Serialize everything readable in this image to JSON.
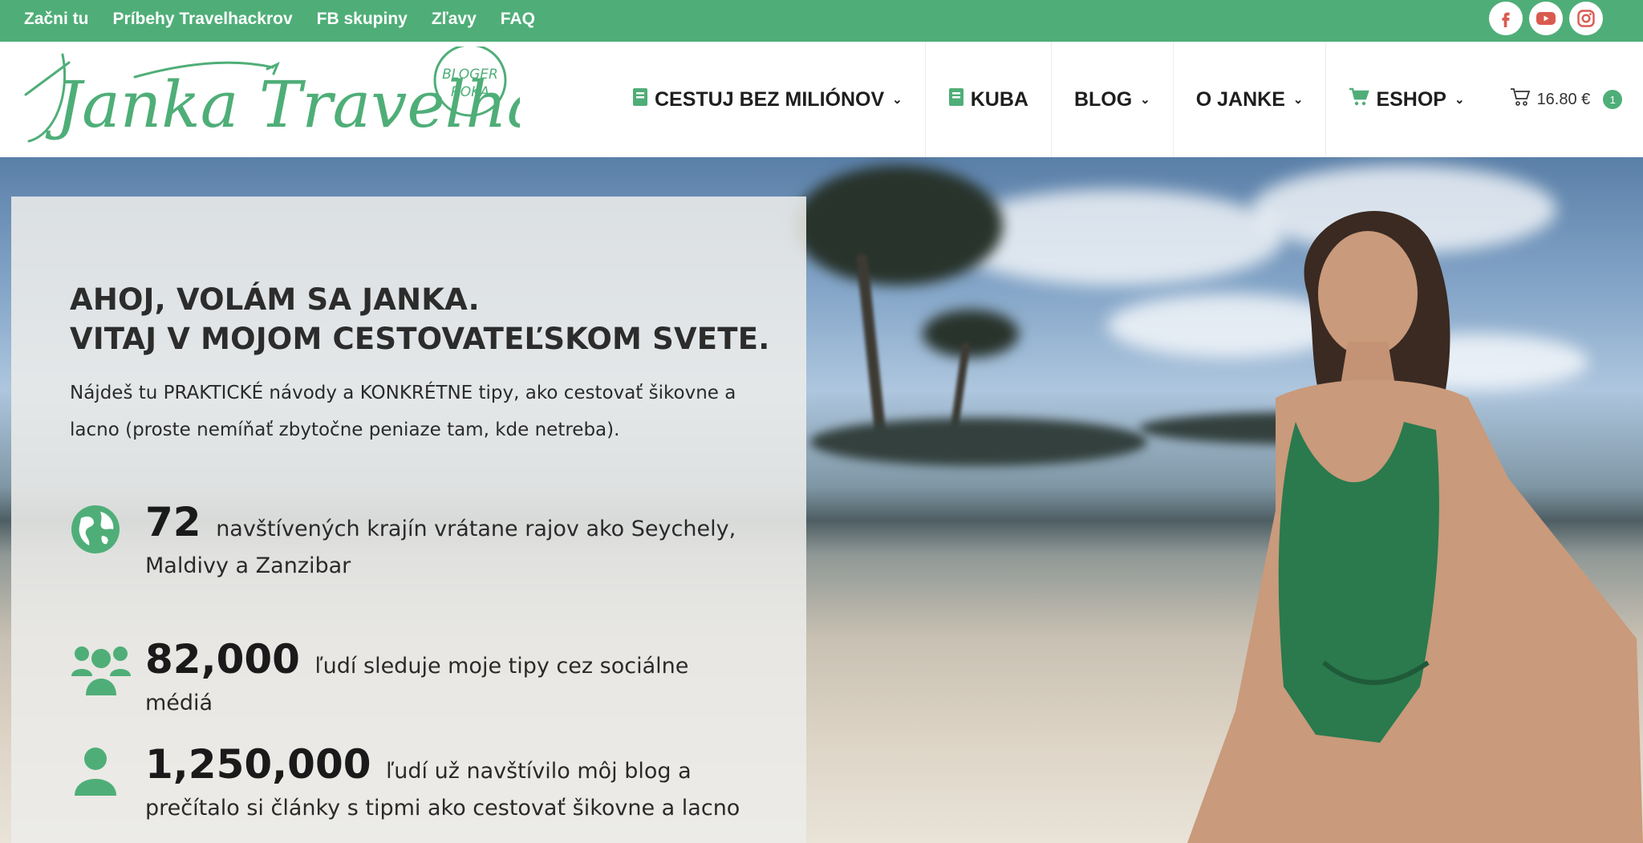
{
  "topbar": {
    "links": [
      "Začni tu",
      "Príbehy Travelhackrov",
      "FB skupiny",
      "Zľavy",
      "FAQ"
    ],
    "socials": [
      "facebook-icon",
      "youtube-icon",
      "instagram-icon"
    ]
  },
  "logo": {
    "script": "Janka Travelhacker",
    "badge_line1": "BLOGER",
    "badge_line2": "ROKA"
  },
  "nav": {
    "cestuj": "CESTUJ BEZ MILIÓNOV",
    "kuba": "KUBA",
    "blog": "BLOG",
    "janke": "O JANKE",
    "eshop": "ESHOP",
    "cart_total": "16.80 €",
    "cart_count": "1"
  },
  "hero": {
    "title_line1": "AHOJ, VOLÁM SA JANKA.",
    "title_line2": "VITAJ V MOJOM CESTOVATEĽSKOM SVETE.",
    "intro": "Nájdeš tu PRAKTICKÉ návody a KONKRÉTNE tipy, ako cestovať šikovne a lacno (proste nemíňať zbytočne peniaze tam, kde netreba).",
    "stats": [
      {
        "number": "72",
        "text": "navštívených krajín vrátane rajov ako Seychely, Maldivy a Zanzibar"
      },
      {
        "number": "82,000",
        "text": "ľudí sleduje moje tipy cez sociálne médiá"
      },
      {
        "number": "1,250,000",
        "text": "ľudí už navštívilo môj blog a prečítalo si články s tipmi ako cestovať šikovne a lacno"
      }
    ]
  },
  "colors": {
    "brand_green": "#4fae78",
    "text_dark": "#2c2c2c"
  }
}
